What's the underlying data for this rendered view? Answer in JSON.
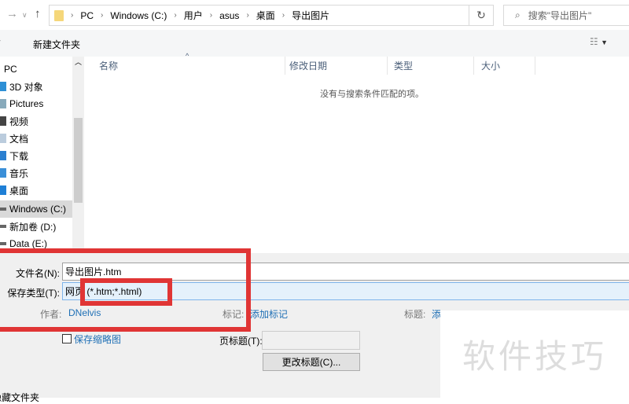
{
  "address": {
    "segments": [
      "PC",
      "Windows (C:)",
      "用户",
      "asus",
      "桌面",
      "导出图片"
    ]
  },
  "search": {
    "placeholder": "搜索\"导出图片\""
  },
  "toolbar": {
    "new_folder": "新建文件夹"
  },
  "nav": {
    "items": [
      "PC",
      "3D 对象",
      "Pictures",
      "视频",
      "文档",
      "下载",
      "音乐",
      "桌面",
      "Windows (C:)",
      "新加卷 (D:)",
      "Data (E:)"
    ]
  },
  "columns": [
    "名称",
    "修改日期",
    "类型",
    "大小"
  ],
  "empty_message": "没有与搜索条件匹配的项。",
  "form": {
    "filename_label": "文件名(N):",
    "filename_value": "导出图片.htm",
    "type_label": "保存类型(T):",
    "type_value": "网页 (*.htm;*.html)",
    "author_label": "作者:",
    "author_value": "DNelvis",
    "tags_label": "标记:",
    "tags_value": "添加标记",
    "title_label": "标题:",
    "title_value": "添",
    "thumbnail_label": "保存缩略图",
    "page_title_label": "页标题(T):",
    "change_title_button": "更改标题(C)...",
    "hide_folders": "隐藏文件夹"
  },
  "watermark": "软件技巧"
}
